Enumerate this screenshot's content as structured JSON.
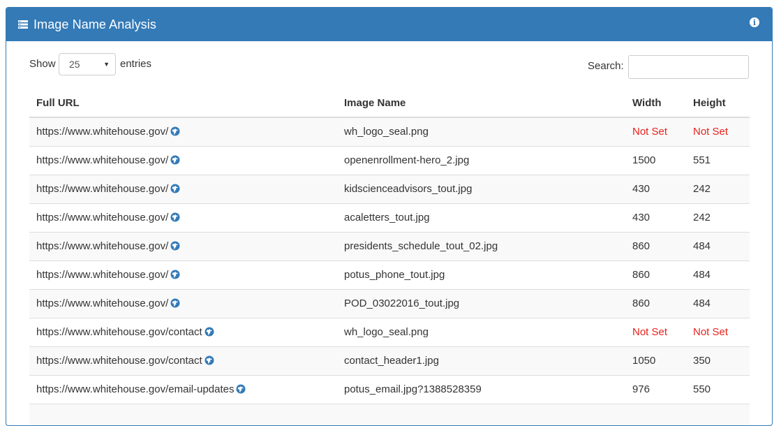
{
  "panel": {
    "title": "Image Name Analysis",
    "icon": "server-icon",
    "info_icon": "info-icon",
    "info_glyph": "i",
    "accent_color": "#337ab7"
  },
  "controls": {
    "show_label": "Show",
    "page_length": "25",
    "entries_label": "entries",
    "search_label": "Search:",
    "search_value": ""
  },
  "table": {
    "columns": [
      "Full URL",
      "Image Name",
      "Width",
      "Height"
    ],
    "rows": [
      {
        "url": "https://www.whitehouse.gov/",
        "image": "wh_logo_seal.png",
        "width": "Not Set",
        "height": "Not Set"
      },
      {
        "url": "https://www.whitehouse.gov/",
        "image": "openenrollment-hero_2.jpg",
        "width": "1500",
        "height": "551"
      },
      {
        "url": "https://www.whitehouse.gov/",
        "image": "kidscienceadvisors_tout.jpg",
        "width": "430",
        "height": "242"
      },
      {
        "url": "https://www.whitehouse.gov/",
        "image": "acaletters_tout.jpg",
        "width": "430",
        "height": "242"
      },
      {
        "url": "https://www.whitehouse.gov/",
        "image": "presidents_schedule_tout_02.jpg",
        "width": "860",
        "height": "484"
      },
      {
        "url": "https://www.whitehouse.gov/",
        "image": "potus_phone_tout.jpg",
        "width": "860",
        "height": "484"
      },
      {
        "url": "https://www.whitehouse.gov/",
        "image": "POD_03022016_tout.jpg",
        "width": "860",
        "height": "484"
      },
      {
        "url": "https://www.whitehouse.gov/contact",
        "image": "wh_logo_seal.png",
        "width": "Not Set",
        "height": "Not Set"
      },
      {
        "url": "https://www.whitehouse.gov/contact",
        "image": "contact_header1.jpg",
        "width": "1050",
        "height": "350"
      },
      {
        "url": "https://www.whitehouse.gov/email-updates",
        "image": "potus_email.jpg?1388528359",
        "width": "976",
        "height": "550"
      },
      {
        "url": "",
        "image": "",
        "width": "",
        "height": ""
      }
    ],
    "not_set_color": "#e8221c",
    "link_icon": "globe-icon"
  }
}
